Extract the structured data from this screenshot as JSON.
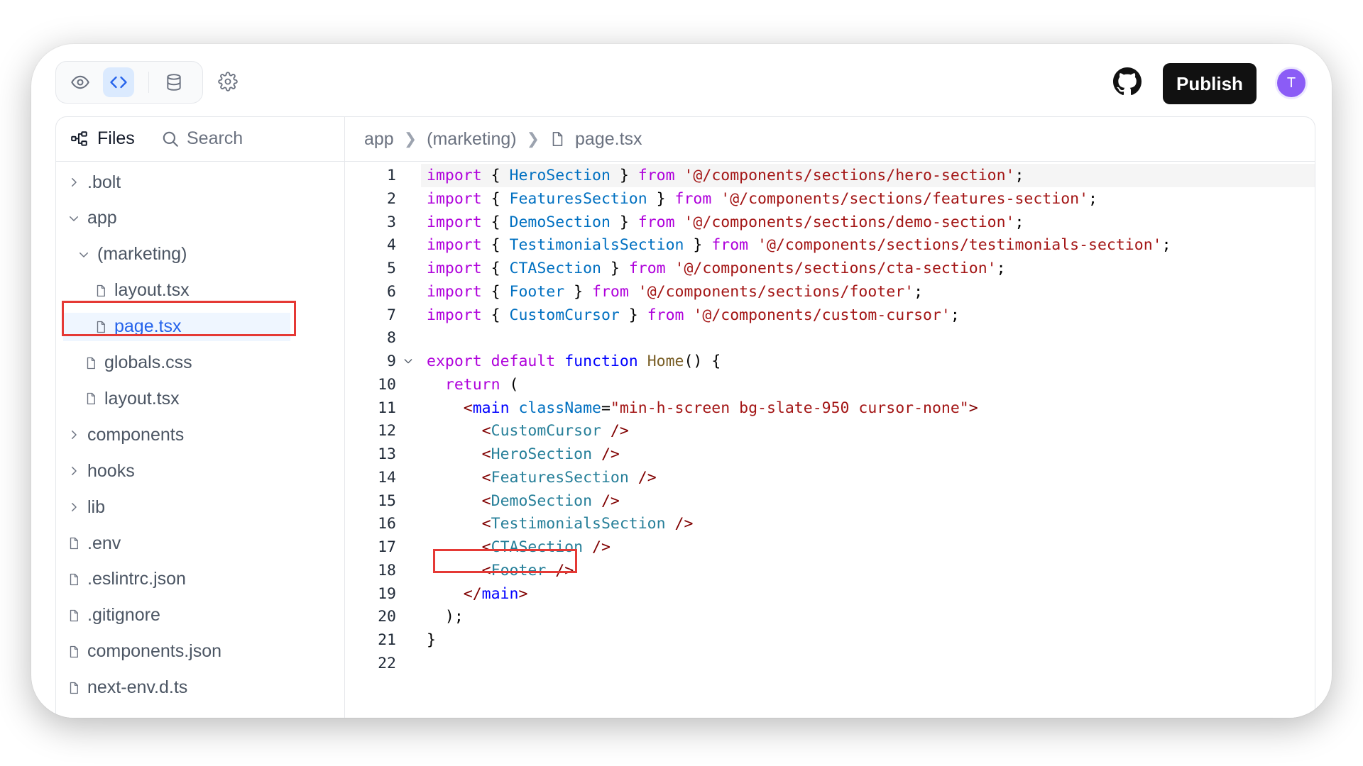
{
  "toolbar": {
    "views": [
      {
        "name": "preview",
        "icon": "eye-icon"
      },
      {
        "name": "code",
        "icon": "code-icon",
        "active": true
      },
      {
        "name": "database",
        "icon": "database-icon"
      }
    ],
    "settings_icon": "gear-icon",
    "github_icon": "github-icon",
    "publish_label": "Publish",
    "avatar_initial": "T"
  },
  "sidebar": {
    "files_label": "Files",
    "search_label": "Search",
    "tree": [
      {
        "label": ".bolt",
        "type": "folder",
        "expanded": false,
        "depth": 0
      },
      {
        "label": "app",
        "type": "folder",
        "expanded": true,
        "depth": 0
      },
      {
        "label": "(marketing)",
        "type": "folder",
        "expanded": true,
        "depth": 1
      },
      {
        "label": "layout.tsx",
        "type": "file",
        "depth": 2
      },
      {
        "label": "page.tsx",
        "type": "file",
        "depth": 2,
        "selected": true
      },
      {
        "label": "globals.css",
        "type": "file",
        "depth": 1
      },
      {
        "label": "layout.tsx",
        "type": "file",
        "depth": 1
      },
      {
        "label": "components",
        "type": "folder",
        "expanded": false,
        "depth": 0
      },
      {
        "label": "hooks",
        "type": "folder",
        "expanded": false,
        "depth": 0
      },
      {
        "label": "lib",
        "type": "folder",
        "expanded": false,
        "depth": 0
      },
      {
        "label": ".env",
        "type": "file",
        "depth": 0
      },
      {
        "label": ".eslintrc.json",
        "type": "file",
        "depth": 0
      },
      {
        "label": ".gitignore",
        "type": "file",
        "depth": 0
      },
      {
        "label": "components.json",
        "type": "file",
        "depth": 0
      },
      {
        "label": "next-env.d.ts",
        "type": "file",
        "depth": 0
      }
    ]
  },
  "breadcrumb": {
    "items": [
      "app",
      "(marketing)",
      "page.tsx"
    ]
  },
  "editor": {
    "lines": [
      [
        [
          "kw",
          "import"
        ],
        [
          "pl",
          " { "
        ],
        [
          "id",
          "HeroSection"
        ],
        [
          "pl",
          " } "
        ],
        [
          "kw",
          "from"
        ],
        [
          "pl",
          " "
        ],
        [
          "str",
          "'@/components/sections/hero-section'"
        ],
        [
          "pl",
          ";"
        ]
      ],
      [
        [
          "kw",
          "import"
        ],
        [
          "pl",
          " { "
        ],
        [
          "id",
          "FeaturesSection"
        ],
        [
          "pl",
          " } "
        ],
        [
          "kw",
          "from"
        ],
        [
          "pl",
          " "
        ],
        [
          "str",
          "'@/components/sections/features-section'"
        ],
        [
          "pl",
          ";"
        ]
      ],
      [
        [
          "kw",
          "import"
        ],
        [
          "pl",
          " { "
        ],
        [
          "id",
          "DemoSection"
        ],
        [
          "pl",
          " } "
        ],
        [
          "kw",
          "from"
        ],
        [
          "pl",
          " "
        ],
        [
          "str",
          "'@/components/sections/demo-section'"
        ],
        [
          "pl",
          ";"
        ]
      ],
      [
        [
          "kw",
          "import"
        ],
        [
          "pl",
          " { "
        ],
        [
          "id",
          "TestimonialsSection"
        ],
        [
          "pl",
          " } "
        ],
        [
          "kw",
          "from"
        ],
        [
          "pl",
          " "
        ],
        [
          "str",
          "'@/components/sections/testimonials-section'"
        ],
        [
          "pl",
          ";"
        ]
      ],
      [
        [
          "kw",
          "import"
        ],
        [
          "pl",
          " { "
        ],
        [
          "id",
          "CTASection"
        ],
        [
          "pl",
          " } "
        ],
        [
          "kw",
          "from"
        ],
        [
          "pl",
          " "
        ],
        [
          "str",
          "'@/components/sections/cta-section'"
        ],
        [
          "pl",
          ";"
        ]
      ],
      [
        [
          "kw",
          "import"
        ],
        [
          "pl",
          " { "
        ],
        [
          "id",
          "Footer"
        ],
        [
          "pl",
          " } "
        ],
        [
          "kw",
          "from"
        ],
        [
          "pl",
          " "
        ],
        [
          "str",
          "'@/components/sections/footer'"
        ],
        [
          "pl",
          ";"
        ]
      ],
      [
        [
          "kw",
          "import"
        ],
        [
          "pl",
          " { "
        ],
        [
          "id",
          "CustomCursor"
        ],
        [
          "pl",
          " } "
        ],
        [
          "kw",
          "from"
        ],
        [
          "pl",
          " "
        ],
        [
          "str",
          "'@/components/custom-cursor'"
        ],
        [
          "pl",
          ";"
        ]
      ],
      [],
      [
        [
          "kw",
          "export"
        ],
        [
          "pl",
          " "
        ],
        [
          "kw",
          "default"
        ],
        [
          "pl",
          " "
        ],
        [
          "kw2",
          "function"
        ],
        [
          "pl",
          " "
        ],
        [
          "fn",
          "Home"
        ],
        [
          "pl",
          "() {"
        ]
      ],
      [
        [
          "pl",
          "  "
        ],
        [
          "kw",
          "return"
        ],
        [
          "pl",
          " ("
        ]
      ],
      [
        [
          "pl",
          "    "
        ],
        [
          "ang",
          "<"
        ],
        [
          "kw2",
          "main"
        ],
        [
          "pl",
          " "
        ],
        [
          "attr",
          "className"
        ],
        [
          "pl",
          "="
        ],
        [
          "str",
          "\"min-h-screen bg-slate-950 cursor-none\""
        ],
        [
          "ang",
          ">"
        ]
      ],
      [
        [
          "pl",
          "      "
        ],
        [
          "ang",
          "<"
        ],
        [
          "tag",
          "CustomCursor"
        ],
        [
          "pl",
          " "
        ],
        [
          "ang",
          "/>"
        ]
      ],
      [
        [
          "pl",
          "      "
        ],
        [
          "ang",
          "<"
        ],
        [
          "tag",
          "HeroSection"
        ],
        [
          "pl",
          " "
        ],
        [
          "ang",
          "/>"
        ]
      ],
      [
        [
          "pl",
          "      "
        ],
        [
          "ang",
          "<"
        ],
        [
          "tag",
          "FeaturesSection"
        ],
        [
          "pl",
          " "
        ],
        [
          "ang",
          "/>"
        ]
      ],
      [
        [
          "pl",
          "      "
        ],
        [
          "ang",
          "<"
        ],
        [
          "tag",
          "DemoSection"
        ],
        [
          "pl",
          " "
        ],
        [
          "ang",
          "/>"
        ]
      ],
      [
        [
          "pl",
          "      "
        ],
        [
          "ang",
          "<"
        ],
        [
          "tag",
          "TestimonialsSection"
        ],
        [
          "pl",
          " "
        ],
        [
          "ang",
          "/>"
        ]
      ],
      [
        [
          "pl",
          "      "
        ],
        [
          "ang",
          "<"
        ],
        [
          "tag",
          "CTASection"
        ],
        [
          "pl",
          " "
        ],
        [
          "ang",
          "/>"
        ]
      ],
      [
        [
          "pl",
          "      "
        ],
        [
          "ang",
          "<"
        ],
        [
          "tag",
          "Footer"
        ],
        [
          "pl",
          " "
        ],
        [
          "ang",
          "/>"
        ]
      ],
      [
        [
          "pl",
          "    "
        ],
        [
          "ang",
          "</"
        ],
        [
          "kw2",
          "main"
        ],
        [
          "ang",
          ">"
        ]
      ],
      [
        [
          "pl",
          "  );"
        ]
      ],
      [
        [
          "pl",
          "}"
        ]
      ],
      []
    ],
    "line_numbers": [
      "1",
      "2",
      "3",
      "4",
      "5",
      "6",
      "7",
      "8",
      "9",
      "10",
      "11",
      "12",
      "13",
      "14",
      "15",
      "16",
      "17",
      "18",
      "19",
      "20",
      "21",
      "22"
    ],
    "current_line": 1,
    "fold_line": 9
  },
  "annotations": {
    "color": "#e53935",
    "highlighted_file": "page.tsx",
    "highlighted_code_line": 18
  }
}
